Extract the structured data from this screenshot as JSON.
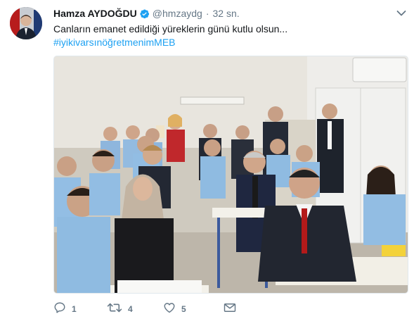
{
  "tweet": {
    "author_name": "Hamza AYDOĞDU",
    "handle": "@hmzaydg",
    "separator": "·",
    "time": "32 sn.",
    "text": "Canların emanet edildiği yüreklerin günü kutlu olsun...",
    "hashtag": "#iyikivarsınöğretmenimMEB",
    "verified": true
  },
  "actions": {
    "reply_count": "1",
    "retweet_count": "4",
    "like_count": "5"
  },
  "icons": {
    "verified": "verified-badge-icon",
    "caret": "chevron-down-icon",
    "reply": "reply-icon",
    "retweet": "retweet-icon",
    "like": "heart-icon",
    "dm": "envelope-icon"
  },
  "colors": {
    "link": "#1da1f2",
    "secondary_text": "#657786",
    "primary_text": "#14171a"
  }
}
